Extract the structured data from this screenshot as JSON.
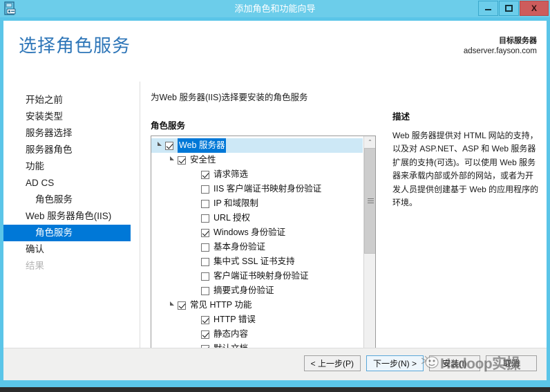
{
  "window": {
    "title": "添加角色和功能向导",
    "icon": "server-manager-icon",
    "controls": {
      "minimize": "–",
      "maximize": "❐",
      "close": "X"
    }
  },
  "header": {
    "page_title": "选择角色服务",
    "target_server_label": "目标服务器",
    "target_server_name": "adserver.fayson.com"
  },
  "sidebar": {
    "items": [
      {
        "label": "开始之前",
        "level": 0,
        "state": "normal"
      },
      {
        "label": "安装类型",
        "level": 0,
        "state": "normal"
      },
      {
        "label": "服务器选择",
        "level": 0,
        "state": "normal"
      },
      {
        "label": "服务器角色",
        "level": 0,
        "state": "normal"
      },
      {
        "label": "功能",
        "level": 0,
        "state": "normal"
      },
      {
        "label": "AD CS",
        "level": 0,
        "state": "normal"
      },
      {
        "label": "角色服务",
        "level": 1,
        "state": "normal"
      },
      {
        "label": "Web 服务器角色(IIS)",
        "level": 0,
        "state": "normal"
      },
      {
        "label": "角色服务",
        "level": 1,
        "state": "selected"
      },
      {
        "label": "确认",
        "level": 0,
        "state": "normal"
      },
      {
        "label": "结果",
        "level": 0,
        "state": "disabled"
      }
    ]
  },
  "main": {
    "instruction": "为Web 服务器(IIS)选择要安装的角色服务",
    "list_label": "角色服务",
    "tree": [
      {
        "label": "Web 服务器",
        "level": 0,
        "checked": true,
        "expander": "expanded",
        "selected": true
      },
      {
        "label": "安全性",
        "level": 1,
        "checked": true,
        "expander": "expanded",
        "selected": false
      },
      {
        "label": "请求筛选",
        "level": 2,
        "checked": true,
        "expander": "none",
        "selected": false
      },
      {
        "label": "IIS 客户端证书映射身份验证",
        "level": 2,
        "checked": false,
        "expander": "none",
        "selected": false
      },
      {
        "label": "IP 和域限制",
        "level": 2,
        "checked": false,
        "expander": "none",
        "selected": false
      },
      {
        "label": "URL 授权",
        "level": 2,
        "checked": false,
        "expander": "none",
        "selected": false
      },
      {
        "label": "Windows 身份验证",
        "level": 2,
        "checked": true,
        "expander": "none",
        "selected": false
      },
      {
        "label": "基本身份验证",
        "level": 2,
        "checked": false,
        "expander": "none",
        "selected": false
      },
      {
        "label": "集中式 SSL 证书支持",
        "level": 2,
        "checked": false,
        "expander": "none",
        "selected": false
      },
      {
        "label": "客户端证书映射身份验证",
        "level": 2,
        "checked": false,
        "expander": "none",
        "selected": false
      },
      {
        "label": "摘要式身份验证",
        "level": 2,
        "checked": false,
        "expander": "none",
        "selected": false
      },
      {
        "label": "常见 HTTP 功能",
        "level": 1,
        "checked": true,
        "expander": "expanded",
        "selected": false
      },
      {
        "label": "HTTP 错误",
        "level": 2,
        "checked": true,
        "expander": "none",
        "selected": false
      },
      {
        "label": "静态内容",
        "level": 2,
        "checked": true,
        "expander": "none",
        "selected": false
      },
      {
        "label": "默认文档",
        "level": 2,
        "checked": true,
        "expander": "none",
        "selected": false
      }
    ],
    "scrollbar": {
      "up_arrow": "⌃",
      "down_arrow": "⌄"
    }
  },
  "description": {
    "title": "描述",
    "body": "Web 服务器提供对 HTML 网站的支持，以及对 ASP.NET、ASP 和 Web 服务器扩展的支持(可选)。可以使用 Web 服务器来承载内部或外部的网站，或者为开发人员提供创建基于 Web 的应用程序的环境。"
  },
  "footer": {
    "buttons": [
      {
        "label": "< 上一步(P)",
        "style": "normal"
      },
      {
        "label": "下一步(N) >",
        "style": "default"
      },
      {
        "label": "安装(I)",
        "style": "normal"
      },
      {
        "label": "取消",
        "style": "normal"
      }
    ]
  },
  "watermark": {
    "text": "Hadoop实操",
    "icon": "cartoon-face-icon"
  },
  "colors": {
    "titlebar": "#6ccdea",
    "frame": "#5bc5e8",
    "accent": "#0078d7",
    "page_title": "#2e76b8",
    "close_button": "#cd5c5c"
  }
}
